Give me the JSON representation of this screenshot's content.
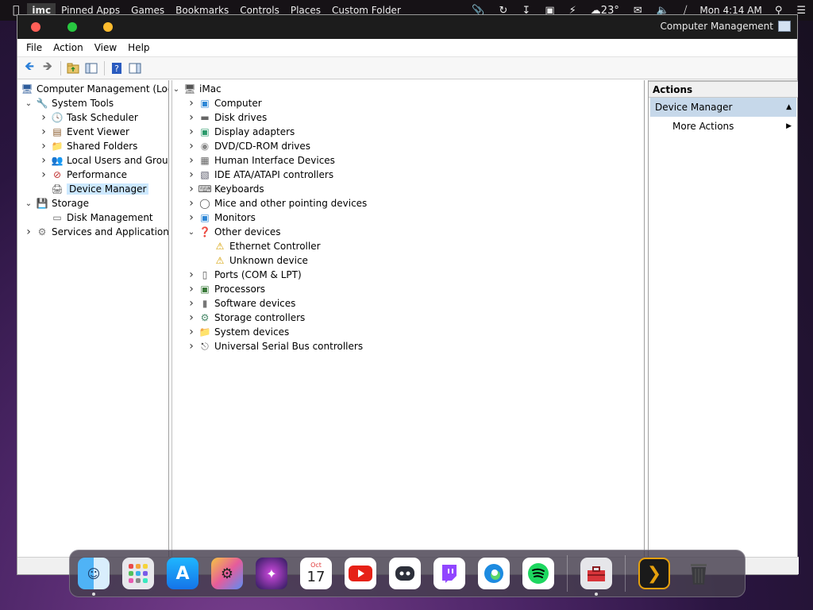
{
  "menubar": {
    "app_name": "imc",
    "items": [
      "Pinned Apps",
      "Games",
      "Bookmarks",
      "Controls",
      "Places",
      "Custom Folder"
    ],
    "temperature": "23°",
    "clock": "Mon 4:14 AM"
  },
  "window": {
    "title": "Computer Management",
    "menus": [
      "File",
      "Action",
      "View",
      "Help"
    ]
  },
  "tree": [
    {
      "label": "Computer Management (Local",
      "level": 0,
      "chev": "",
      "icon": "computer-management-icon"
    },
    {
      "label": "System Tools",
      "level": 1,
      "chev": "down",
      "icon": "system-tools-icon"
    },
    {
      "label": "Task Scheduler",
      "level": 2,
      "chev": "right",
      "icon": "clock-icon"
    },
    {
      "label": "Event Viewer",
      "level": 2,
      "chev": "right",
      "icon": "event-viewer-icon"
    },
    {
      "label": "Shared Folders",
      "level": 2,
      "chev": "right",
      "icon": "shared-folder-icon"
    },
    {
      "label": "Local Users and Groups",
      "level": 2,
      "chev": "right",
      "icon": "users-icon"
    },
    {
      "label": "Performance",
      "level": 2,
      "chev": "right",
      "icon": "performance-icon"
    },
    {
      "label": "Device Manager",
      "level": 2,
      "chev": "",
      "icon": "device-manager-icon",
      "selected": true
    },
    {
      "label": "Storage",
      "level": 1,
      "chev": "down",
      "icon": "storage-icon"
    },
    {
      "label": "Disk Management",
      "level": 2,
      "chev": "",
      "icon": "disk-management-icon"
    },
    {
      "label": "Services and Applications",
      "level": 1,
      "chev": "right",
      "icon": "services-icon"
    }
  ],
  "devices": [
    {
      "label": "iMac",
      "level": 0,
      "chev": "down",
      "icon": "imac-icon"
    },
    {
      "label": "Computer",
      "level": 1,
      "chev": "right",
      "icon": "monitor-icon"
    },
    {
      "label": "Disk drives",
      "level": 1,
      "chev": "right",
      "icon": "disk-drive-icon"
    },
    {
      "label": "Display adapters",
      "level": 1,
      "chev": "right",
      "icon": "display-adapter-icon"
    },
    {
      "label": "DVD/CD-ROM drives",
      "level": 1,
      "chev": "right",
      "icon": "dvd-icon"
    },
    {
      "label": "Human Interface Devices",
      "level": 1,
      "chev": "right",
      "icon": "hid-icon"
    },
    {
      "label": "IDE ATA/ATAPI controllers",
      "level": 1,
      "chev": "right",
      "icon": "ide-icon"
    },
    {
      "label": "Keyboards",
      "level": 1,
      "chev": "right",
      "icon": "keyboard-icon"
    },
    {
      "label": "Mice and other pointing devices",
      "level": 1,
      "chev": "right",
      "icon": "mouse-icon"
    },
    {
      "label": "Monitors",
      "level": 1,
      "chev": "right",
      "icon": "monitor-icon"
    },
    {
      "label": "Other devices",
      "level": 1,
      "chev": "down",
      "icon": "unknown-device-icon"
    },
    {
      "label": "Ethernet Controller",
      "level": 2,
      "chev": "",
      "icon": "warning-device-icon"
    },
    {
      "label": "Unknown device",
      "level": 2,
      "chev": "",
      "icon": "warning-device-icon"
    },
    {
      "label": "Ports (COM & LPT)",
      "level": 1,
      "chev": "right",
      "icon": "port-icon"
    },
    {
      "label": "Processors",
      "level": 1,
      "chev": "right",
      "icon": "processor-icon"
    },
    {
      "label": "Software devices",
      "level": 1,
      "chev": "right",
      "icon": "software-device-icon"
    },
    {
      "label": "Storage controllers",
      "level": 1,
      "chev": "right",
      "icon": "storage-controller-icon"
    },
    {
      "label": "System devices",
      "level": 1,
      "chev": "right",
      "icon": "system-device-icon"
    },
    {
      "label": "Universal Serial Bus controllers",
      "level": 1,
      "chev": "right",
      "icon": "usb-icon"
    }
  ],
  "actions": {
    "header": "Actions",
    "section": "Device Manager",
    "more": "More Actions"
  },
  "dock": {
    "calendar_month": "Oct",
    "calendar_day": "17"
  }
}
